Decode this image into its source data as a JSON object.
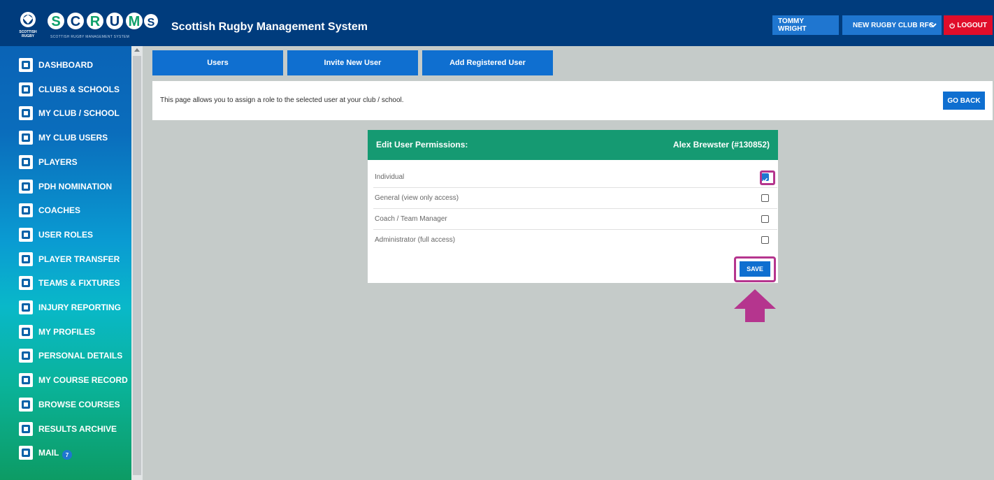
{
  "header": {
    "logo_text": "SCRUMS",
    "logo_subtitle": "SCOTTISH RUGBY MANAGEMENT SYSTEM",
    "crest_text": "SCOTTISH RUGBY",
    "app_title": "Scottish Rugby Management System",
    "user_label": "TOMMY WRIGHT",
    "club_label": "NEW RUGBY CLUB RFC",
    "logout_label": "LOGOUT"
  },
  "sidebar": {
    "items": [
      {
        "label": "DASHBOARD",
        "icon": "dashboard-icon"
      },
      {
        "label": "CLUBS & SCHOOLS",
        "icon": "clubs-icon"
      },
      {
        "label": "MY CLUB / SCHOOL",
        "icon": "my-club-icon"
      },
      {
        "label": "MY CLUB USERS",
        "icon": "club-users-icon"
      },
      {
        "label": "PLAYERS",
        "icon": "player-icon"
      },
      {
        "label": "PDH NOMINATION",
        "icon": "pdh-icon"
      },
      {
        "label": "COACHES",
        "icon": "coach-icon"
      },
      {
        "label": "USER ROLES",
        "icon": "user-roles-icon"
      },
      {
        "label": "PLAYER TRANSFER",
        "icon": "transfer-icon"
      },
      {
        "label": "TEAMS & FIXTURES",
        "icon": "trophy-icon"
      },
      {
        "label": "INJURY REPORTING",
        "icon": "ambulance-icon"
      },
      {
        "label": "MY PROFILES",
        "icon": "profiles-icon"
      },
      {
        "label": "PERSONAL DETAILS",
        "icon": "details-icon"
      },
      {
        "label": "MY COURSE RECORD",
        "icon": "course-record-icon"
      },
      {
        "label": "BROWSE COURSES",
        "icon": "browse-icon"
      },
      {
        "label": "RESULTS ARCHIVE",
        "icon": "archive-icon"
      },
      {
        "label": "MAIL",
        "icon": "mail-icon"
      }
    ],
    "mail_count": "7"
  },
  "tabs": [
    "Users",
    "Invite New User",
    "Add Registered User"
  ],
  "info": {
    "text": "This page allows you to assign a role to the selected user at your club / school.",
    "go_back": "GO BACK"
  },
  "card": {
    "title": "Edit User Permissions:",
    "user": "Alex Brewster (#130852)",
    "roles": [
      {
        "label": "Individual",
        "checked": true
      },
      {
        "label": "General (view only access)",
        "checked": false
      },
      {
        "label": "Coach / Team Manager",
        "checked": false
      },
      {
        "label": "Administrator (full access)",
        "checked": false
      }
    ],
    "save": "SAVE"
  },
  "colors": {
    "header": "#003c7d",
    "accent": "#0f6fd0",
    "card_header": "#159a72",
    "logout": "#e00d2a",
    "highlight": "#b5358e"
  }
}
